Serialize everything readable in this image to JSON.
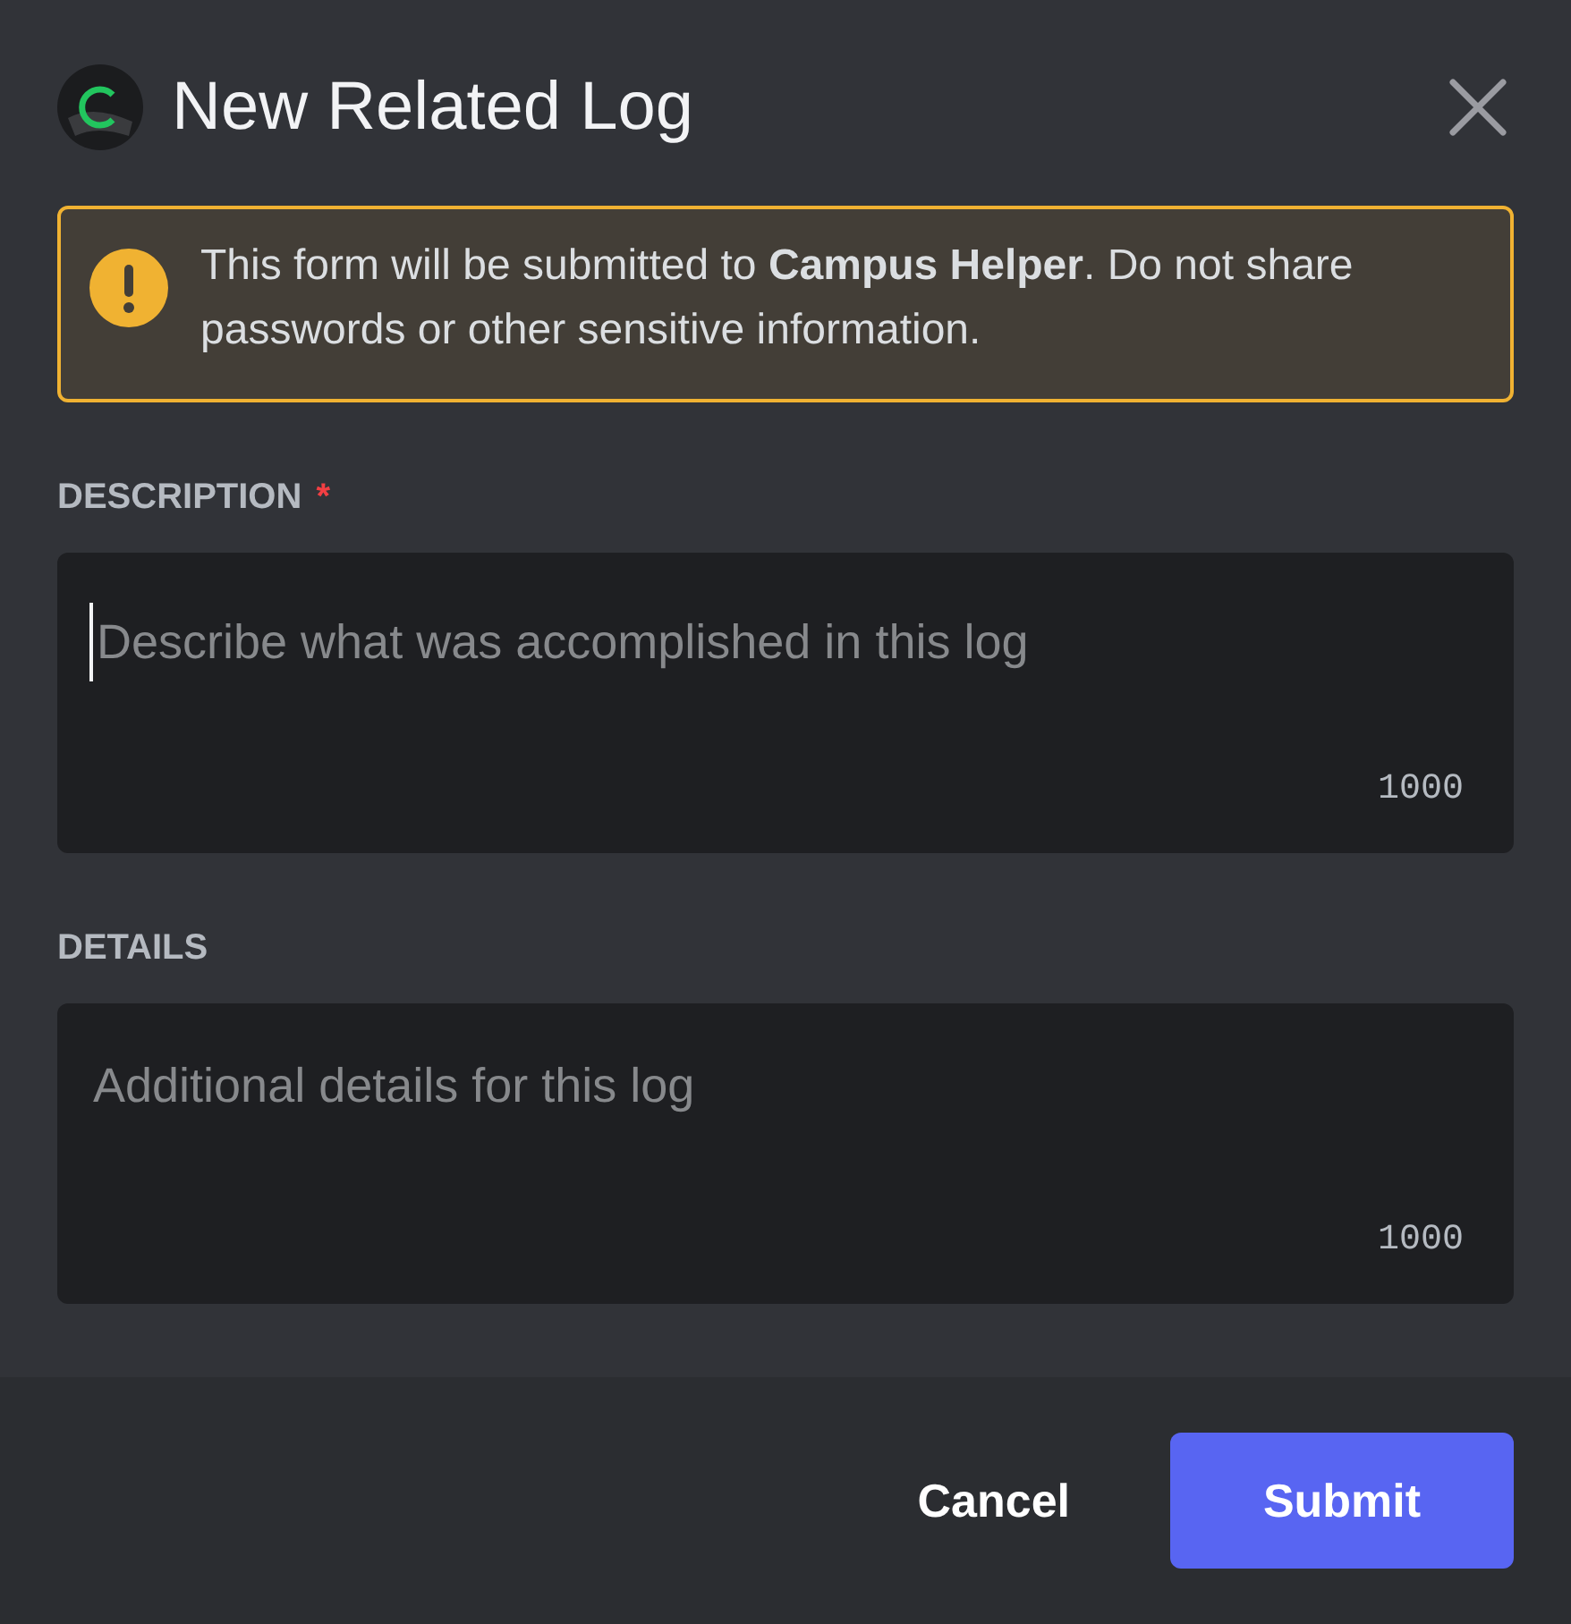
{
  "dialog": {
    "title": "New Related Log"
  },
  "notice": {
    "text": "This form will be submitted to **Campus Helper**. Do not share passwords or other sensitive information."
  },
  "required_marker": "*",
  "fields": [
    {
      "label": "DESCRIPTION",
      "required": true,
      "placeholder": "Describe what was accomplished in this log",
      "counter": "1000",
      "focused": true
    },
    {
      "label": "DETAILS",
      "required": false,
      "placeholder": "Additional details for this log",
      "counter": "1000",
      "focused": false
    }
  ],
  "buttons": [
    {
      "label": "Cancel",
      "kind": "link"
    },
    {
      "label": "Submit",
      "kind": "primary"
    }
  ]
}
